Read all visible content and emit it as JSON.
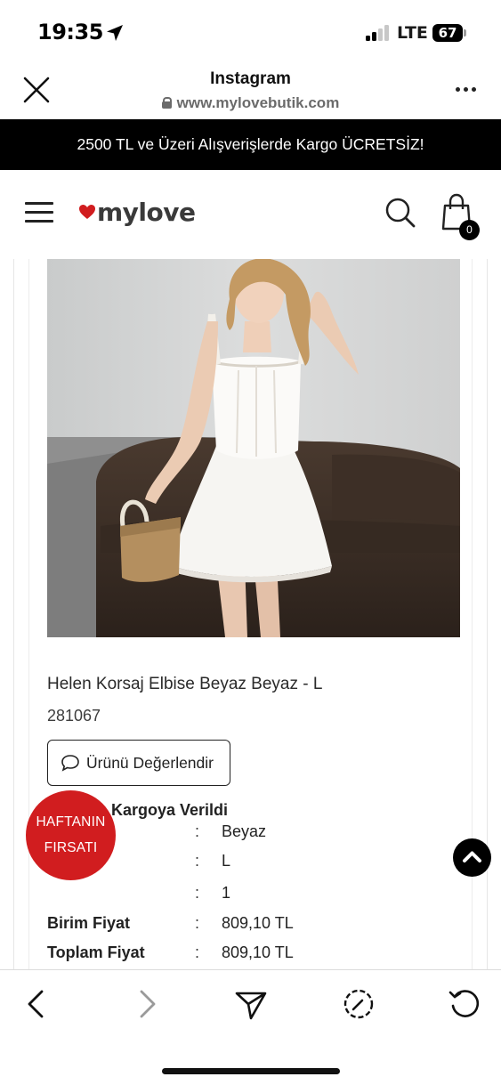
{
  "status_bar": {
    "time": "19:35",
    "network": "LTE",
    "battery": "67"
  },
  "browser": {
    "title": "Instagram",
    "url": "www.mylovebutik.com",
    "icons": [
      "close-icon",
      "lock-icon",
      "more-icon"
    ]
  },
  "promo": {
    "text": "2500 TL ve Üzeri Alışverişlerde Kargo ÜCRETSİZ!"
  },
  "header": {
    "logo_text": "mylove",
    "cart_count": "0",
    "icons": [
      "hamburger-menu-icon",
      "heart-icon",
      "search-icon",
      "shopping-bag-icon"
    ]
  },
  "product": {
    "name": "Helen Korsaj Elbise Beyaz Beyaz - L",
    "code": "281067",
    "review_button": "Ürünü Değerlendir",
    "status": "Kargoya Verildi",
    "details": [
      {
        "label": "",
        "value": "Beyaz"
      },
      {
        "label": "",
        "value": "L"
      },
      {
        "label": "",
        "value": "1"
      },
      {
        "label": "Birim Fiyat",
        "value": "809,10 TL"
      },
      {
        "label": "Toplam Fiyat",
        "value": "809,10 TL"
      }
    ],
    "colon": ":"
  },
  "deal_badge": {
    "line1": "HAFTANIN",
    "line2": "FIRSATI"
  },
  "toolbar": {
    "icons": [
      "back-icon",
      "forward-icon",
      "share-icon",
      "safari-compass-icon",
      "reload-icon"
    ]
  },
  "colors": {
    "promo_bg": "#000000",
    "deal_badge": "#d11d1f",
    "logo_heart": "#d11d1f"
  }
}
